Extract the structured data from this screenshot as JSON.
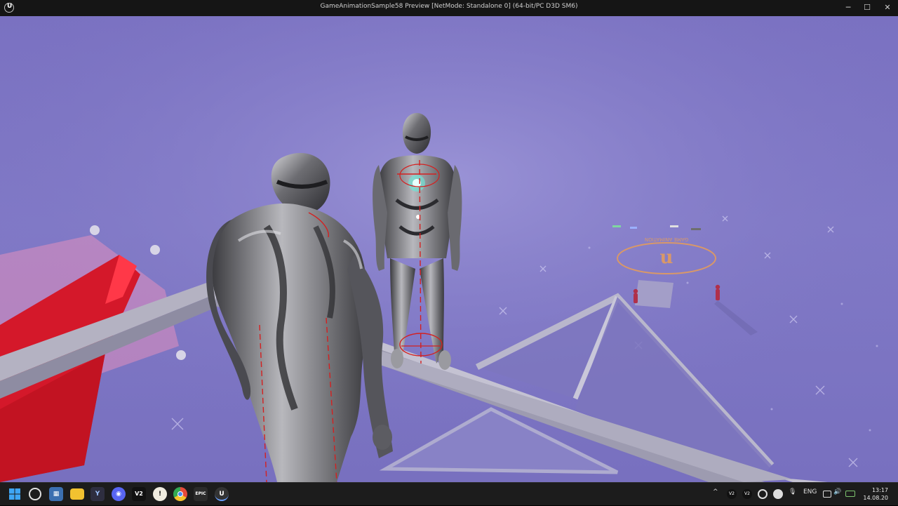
{
  "window": {
    "title": "GameAnimationSample58 Preview [NetMode: Standalone 0]  (64-bit/PC D3D SM6)",
    "minimize": "─",
    "maximize": "☐",
    "close": "✕"
  },
  "taskbar": {
    "apps": [
      {
        "name": "start",
        "icon": "windows-logo-icon"
      },
      {
        "name": "chatgpt",
        "icon": "openai-icon"
      },
      {
        "name": "calculator",
        "icon": "calculator-icon"
      },
      {
        "name": "file-explorer",
        "icon": "folder-icon"
      },
      {
        "name": "yandex",
        "icon": "yandex-icon",
        "label": "Y"
      },
      {
        "name": "discord",
        "icon": "discord-icon"
      },
      {
        "name": "v2",
        "icon": "v2-icon",
        "label": "V2"
      },
      {
        "name": "app-circle",
        "icon": "circle-app-icon"
      },
      {
        "name": "chrome",
        "icon": "chrome-icon"
      },
      {
        "name": "epic-games",
        "icon": "epic-icon",
        "label": "EPIC"
      },
      {
        "name": "unreal-engine",
        "icon": "unreal-icon",
        "label": "U"
      }
    ],
    "tray": {
      "language": "ENG",
      "v2_label": "V2",
      "time": "13:17",
      "date": "14.08.20"
    }
  },
  "scene": {
    "pad_label": "GAME ANIMATION"
  }
}
